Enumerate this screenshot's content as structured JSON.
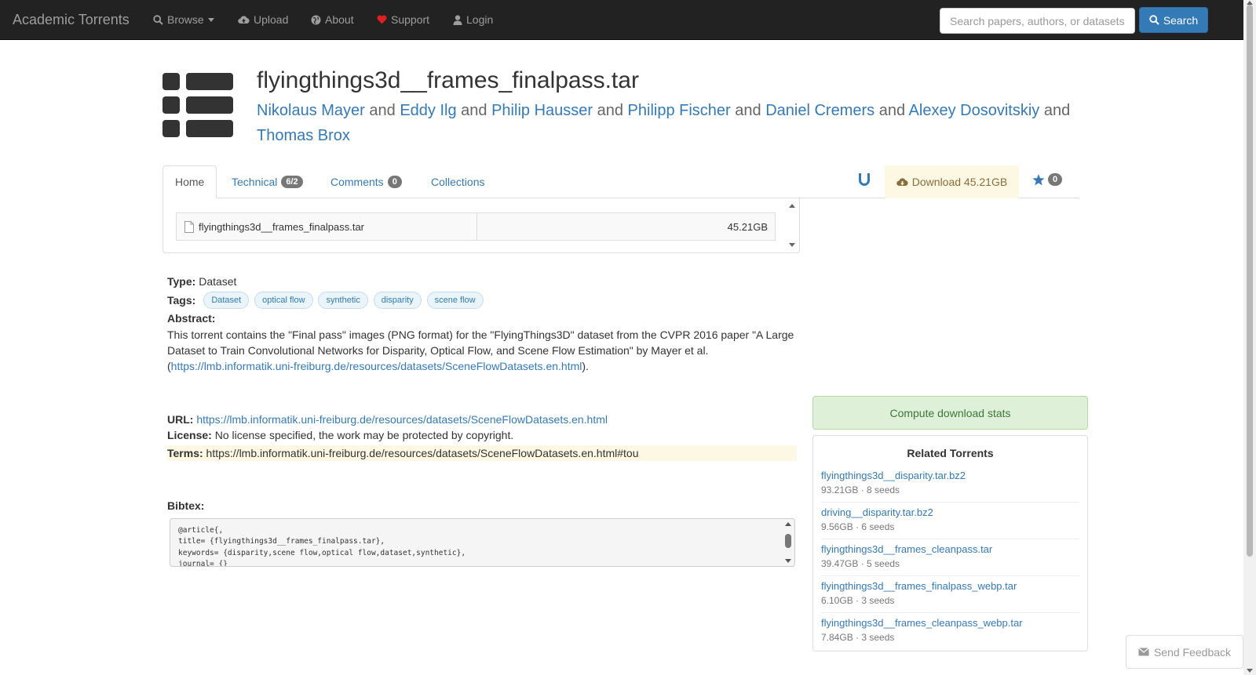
{
  "navbar": {
    "brand": "Academic Torrents",
    "browse": "Browse",
    "upload": "Upload",
    "about": "About",
    "support": "Support",
    "login": "Login",
    "search_placeholder": "Search papers, authors, or datasets",
    "search_button": "Search"
  },
  "torrent": {
    "title": "flyingthings3d__frames_finalpass.tar",
    "authors": [
      "Nikolaus Mayer",
      "Eddy Ilg",
      "Philip Hausser",
      "Philipp Fischer",
      "Daniel Cremers",
      "Alexey Dosovitskiy",
      "Thomas Brox"
    ],
    "and_word": "and"
  },
  "tabs": {
    "home": "Home",
    "technical": "Technical",
    "technical_badge": "6/2",
    "comments": "Comments",
    "comments_badge": "0",
    "collections": "Collections",
    "download": "Download 45.21GB",
    "star_count": "0"
  },
  "files": [
    {
      "name": "flyingthings3d__frames_finalpass.tar",
      "size": "45.21GB"
    }
  ],
  "details": {
    "type_label": "Type:",
    "type_value": "Dataset",
    "tags_label": "Tags:",
    "tags": [
      "Dataset",
      "optical flow",
      "synthetic",
      "disparity",
      "scene flow"
    ],
    "abstract_label": "Abstract:",
    "abstract_text": "This torrent contains the \"Final pass\" images (PNG format) for the \"FlyingThings3D\" dataset from the CVPR 2016 paper \"A Large Dataset to Train Convolutional Networks for Disparity, Optical Flow, and Scene Flow Estimation\" by Mayer et al. (",
    "abstract_link": "https://lmb.informatik.uni-freiburg.de/resources/datasets/SceneFlowDatasets.en.html",
    "abstract_end": ").",
    "url_label": "URL:",
    "url_value": "https://lmb.informatik.uni-freiburg.de/resources/datasets/SceneFlowDatasets.en.html",
    "license_label": "License:",
    "license_value": "No license specified, the work may be protected by copyright.",
    "terms_label": "Terms:",
    "terms_value": "https://lmb.informatik.uni-freiburg.de/resources/datasets/SceneFlowDatasets.en.html#tou",
    "bibtex_label": "Bibtex:",
    "bibtex_text": "@article{,\ntitle= {flyingthings3d__frames_finalpass.tar},\nkeywords= {disparity,scene flow,optical flow,dataset,synthetic},\njournal= {}"
  },
  "sidebar": {
    "stats_button": "Compute download stats",
    "related_title": "Related Torrents",
    "related": [
      {
        "name": "flyingthings3d__disparity.tar.bz2",
        "meta": "93.21GB · 8 seeds"
      },
      {
        "name": "driving__disparity.tar.bz2",
        "meta": "9.56GB · 6 seeds"
      },
      {
        "name": "flyingthings3d__frames_cleanpass.tar",
        "meta": "39.47GB · 5 seeds"
      },
      {
        "name": "flyingthings3d__frames_finalpass_webp.tar",
        "meta": "6.10GB · 3 seeds"
      },
      {
        "name": "flyingthings3d__frames_cleanpass_webp.tar",
        "meta": "7.84GB · 3 seeds"
      }
    ]
  },
  "feedback": "Send Feedback",
  "colors": {
    "navbar_bg": "#222222",
    "link": "#337ab7",
    "download_bg": "#fcf8e3",
    "stats_bg": "#dff0d8",
    "support_heart": "#e02020"
  }
}
